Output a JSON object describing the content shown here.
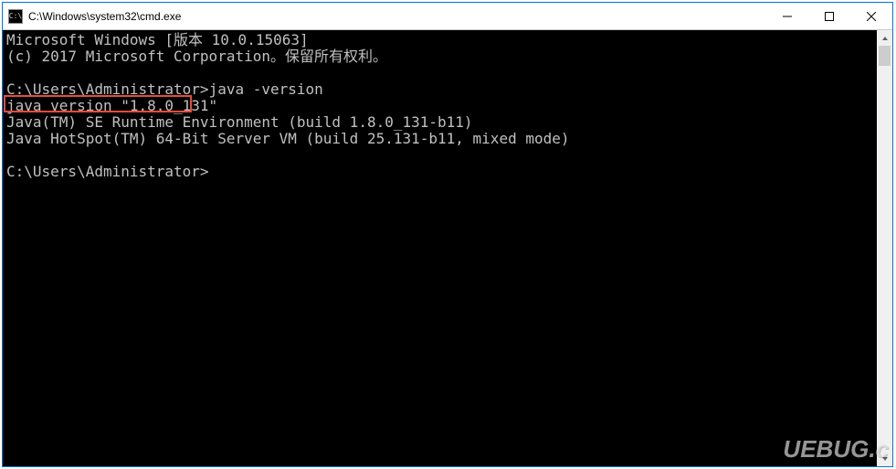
{
  "titlebar": {
    "icon_label": "C:\\",
    "title": "C:\\Windows\\system32\\cmd.exe"
  },
  "console": {
    "line1": "Microsoft Windows [版本 10.0.15063]",
    "line2": "(c) 2017 Microsoft Corporation。保留所有权利。",
    "line3": "",
    "line4_prompt": "C:\\Users\\Administrator>",
    "line4_cmd": "java -version",
    "line5": "java version \"1.8.0_131\"",
    "line6": "Java(TM) SE Runtime Environment (build 1.8.0_131-b11)",
    "line7": "Java HotSpot(TM) 64-Bit Server VM (build 25.131-b11, mixed mode)",
    "line8": "",
    "line9": "C:\\Users\\Administrator>"
  },
  "watermark": "UEBUG.c"
}
